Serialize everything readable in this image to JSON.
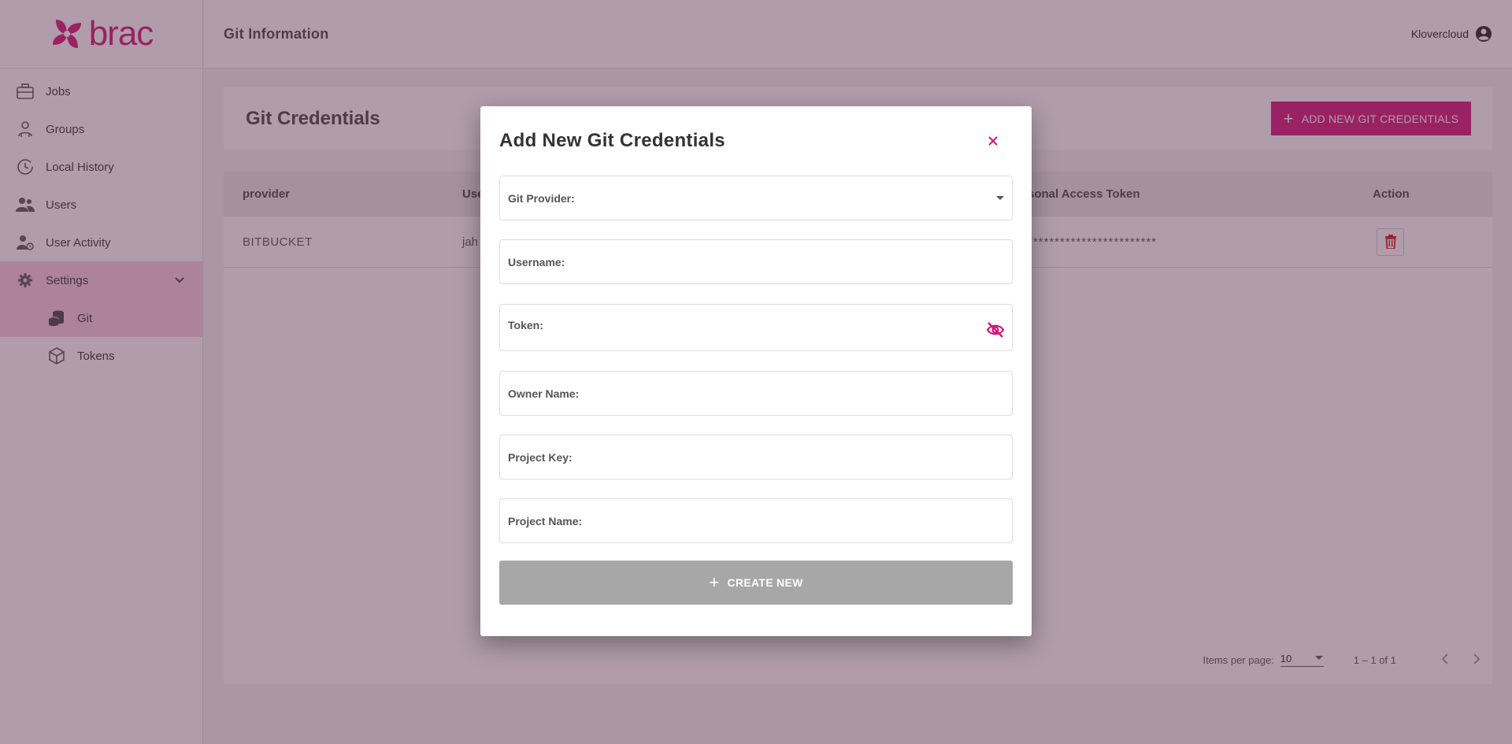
{
  "brand": {
    "name": "brac",
    "color": "#d4157a"
  },
  "sidebar": {
    "items": [
      {
        "label": "Jobs",
        "icon": "briefcase-icon"
      },
      {
        "label": "Groups",
        "icon": "groups-icon"
      },
      {
        "label": "Local History",
        "icon": "history-icon"
      },
      {
        "label": "Users",
        "icon": "users-icon"
      },
      {
        "label": "User Activity",
        "icon": "user-activity-icon"
      },
      {
        "label": "Settings",
        "icon": "gear-icon",
        "expanded": true
      }
    ],
    "subitems": [
      {
        "label": "Git",
        "icon": "coins-stack-icon",
        "active": true
      },
      {
        "label": "Tokens",
        "icon": "cube-icon"
      }
    ]
  },
  "header": {
    "title": "Git Information",
    "user": "Klovercloud"
  },
  "main": {
    "title": "Git Credentials",
    "add_button": "ADD NEW GIT CREDENTIALS",
    "table": {
      "columns": [
        "provider",
        "Use",
        "sonal Access Token",
        "Action"
      ],
      "rows": [
        {
          "provider": "BITBUCKET",
          "username": "jah",
          "token": "************************"
        }
      ]
    },
    "paginator": {
      "label": "Items per page:",
      "page_size": "10",
      "range": "1 – 1 of 1"
    }
  },
  "modal": {
    "title": "Add New Git Credentials",
    "fields": {
      "provider": "Git Provider:",
      "username": "Username:",
      "token": "Token:",
      "owner": "Owner Name:",
      "project_key": "Project Key:",
      "project_name": "Project Name:"
    },
    "submit": "CREATE NEW"
  }
}
